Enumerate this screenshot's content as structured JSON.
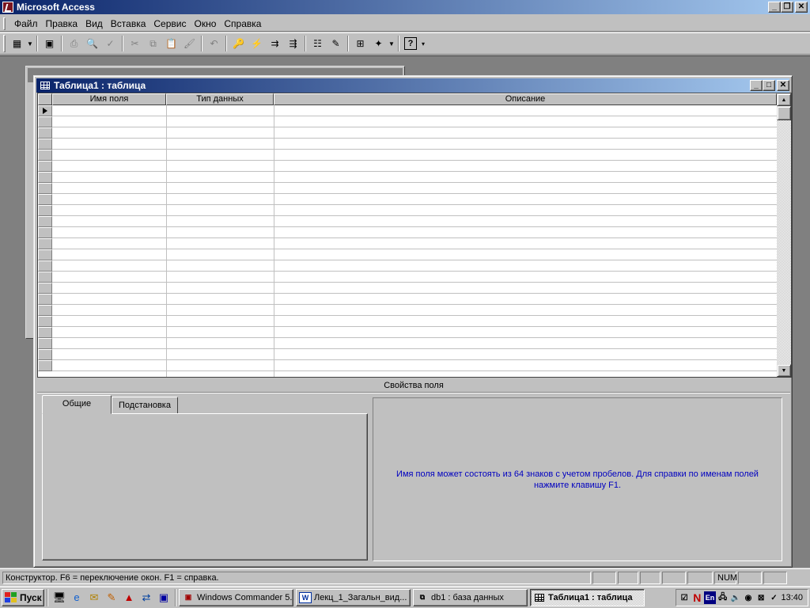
{
  "app": {
    "title": "Microsoft Access"
  },
  "menu": [
    "Файл",
    "Правка",
    "Вид",
    "Вставка",
    "Сервис",
    "Окно",
    "Справка"
  ],
  "toolbar": {
    "buttons": [
      {
        "name": "view-icon",
        "glyph": "▦"
      },
      {
        "name": "save-icon",
        "glyph": "▣"
      },
      {
        "name": "print-icon",
        "glyph": "⎙"
      },
      {
        "name": "preview-icon",
        "glyph": "🔍"
      },
      {
        "name": "spelling-icon",
        "glyph": "✓"
      },
      {
        "name": "cut-icon",
        "glyph": "✂"
      },
      {
        "name": "copy-icon",
        "glyph": "⧉"
      },
      {
        "name": "paste-icon",
        "glyph": "📋"
      },
      {
        "name": "format-painter-icon",
        "glyph": "🖌"
      },
      {
        "name": "undo-icon",
        "glyph": "↶"
      },
      {
        "name": "primary-key-icon",
        "glyph": "🔑"
      },
      {
        "name": "indexes-icon",
        "glyph": "⚡"
      },
      {
        "name": "insert-rows-icon",
        "glyph": "⇉"
      },
      {
        "name": "delete-rows-icon",
        "glyph": "⇶"
      },
      {
        "name": "properties-icon",
        "glyph": "☷"
      },
      {
        "name": "build-icon",
        "glyph": "✎"
      },
      {
        "name": "database-window-icon",
        "glyph": "⊞"
      },
      {
        "name": "new-object-icon",
        "glyph": "✦"
      },
      {
        "name": "help-icon",
        "glyph": "?"
      }
    ]
  },
  "table_window": {
    "title": "Таблица1 : таблица",
    "columns": [
      "Имя поля",
      "Тип данных",
      "Описание"
    ]
  },
  "properties": {
    "title": "Свойства поля",
    "tabs": [
      "Общие",
      "Подстановка"
    ],
    "hint": "Имя поля может состоять из 64 знаков с учетом пробелов.  Для справки по именам полей нажмите клавишу F1."
  },
  "status": {
    "text": "Конструктор.  F6 = переключение окон.  F1 = справка.",
    "num": "NUM"
  },
  "taskbar": {
    "start": "Пуск",
    "tasks": [
      "Windows Commander 5...",
      "Лекц_1_Загальн_вид...",
      "db1 : база данных",
      "Таблица1 : таблица"
    ],
    "tray_lang": "En",
    "clock": "13:40"
  },
  "colors": {
    "title_start": "#0a246a",
    "title_end": "#a6caf0",
    "hint_text": "#0000c0",
    "desktop": "#808080"
  }
}
